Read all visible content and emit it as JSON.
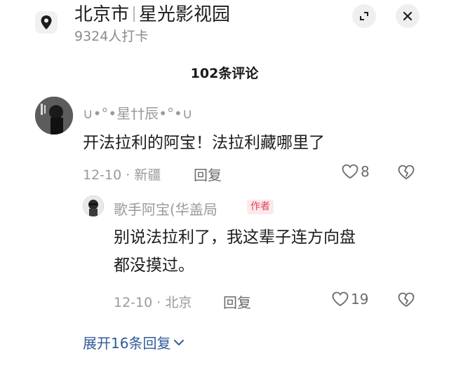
{
  "location": {
    "city": "北京市",
    "place": "星光影视园",
    "checkins": "9324人打卡",
    "icons": {
      "pin": "location-pin-icon",
      "expand": "expand-icon",
      "close": "close-icon"
    }
  },
  "comments_header": {
    "title": "102条评论"
  },
  "comment": {
    "username": "∪•°•星††辰•°•∪",
    "text": "开法拉利的阿宝！法拉利藏哪里了",
    "time_location": "12-10 · 新疆",
    "reply_label": "回复",
    "likes": "8"
  },
  "reply": {
    "username": "歌手阿宝(华盖局",
    "badge": "作者",
    "text_line1": "别说法拉利了，我这辈子连方向盘",
    "text_line2": "都没摸过。",
    "time_location": "12-10 · 北京",
    "reply_label": "回复",
    "likes": "19"
  },
  "expand": {
    "label": "展开16条回复"
  },
  "colors": {
    "link": "#2f5b9a",
    "badge_text": "#e0455a",
    "badge_bg": "#fde8ea",
    "meta": "#9a9a9a"
  }
}
